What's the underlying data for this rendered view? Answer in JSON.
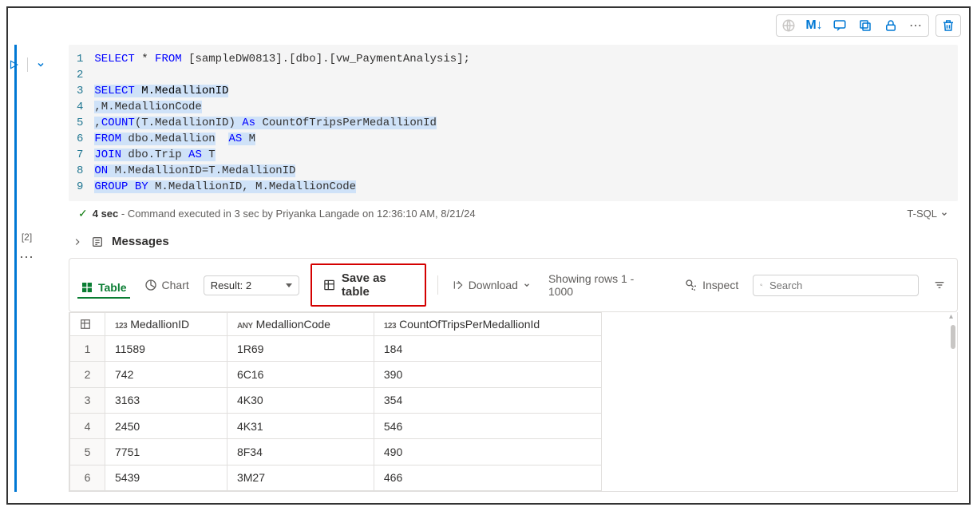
{
  "toolbar_top": {
    "md_label": "M↓"
  },
  "code": {
    "lines": [
      1,
      2,
      3,
      4,
      5,
      6,
      7,
      8,
      9
    ],
    "l1": {
      "a": "SELECT",
      "b": "*",
      "c": "FROM",
      "d": "[sampleDW0813].[dbo].[vw_PaymentAnalysis];"
    },
    "l3": {
      "a": "SELECT",
      "b": "M.MedallionID"
    },
    "l4": {
      "a": ",M.MedallionCode"
    },
    "l5": {
      "a": ",",
      "b": "COUNT",
      "c": "(T.MedallionID)",
      "d": "As",
      "e": "CountOfTripsPerMedallionId"
    },
    "l6": {
      "a": "FROM",
      "b": "dbo.Medallion",
      "c": "AS",
      "d": "M"
    },
    "l7": {
      "a": "JOIN",
      "b": "dbo.Trip",
      "c": "AS",
      "d": "T"
    },
    "l8": {
      "a": "ON",
      "b": "M.MedallionID=T.MedallionID"
    },
    "l9": {
      "a": "GROUP BY",
      "b": "M.MedallionID, M.MedallionCode"
    }
  },
  "cell_index": "[2]",
  "status": {
    "time": "4 sec",
    "msg": " - Command executed in 3 sec by Priyanka Langade on 12:36:10 AM, 8/21/24",
    "lang": "T-SQL"
  },
  "messages_title": "Messages",
  "results_bar": {
    "table": "Table",
    "chart": "Chart",
    "result_dd": "Result: 2",
    "save": "Save as table",
    "download": "Download",
    "showing": "Showing rows 1 - 1000",
    "inspect": "Inspect",
    "search_ph": "Search"
  },
  "table": {
    "cols": [
      {
        "type": "123",
        "name": "MedallionID"
      },
      {
        "type": "ANY",
        "name": "MedallionCode"
      },
      {
        "type": "123",
        "name": "CountOfTripsPerMedallionId"
      }
    ],
    "rows": [
      {
        "n": 1,
        "c": [
          "11589",
          "1R69",
          "184"
        ]
      },
      {
        "n": 2,
        "c": [
          "742",
          "6C16",
          "390"
        ]
      },
      {
        "n": 3,
        "c": [
          "3163",
          "4K30",
          "354"
        ]
      },
      {
        "n": 4,
        "c": [
          "2450",
          "4K31",
          "546"
        ]
      },
      {
        "n": 5,
        "c": [
          "7751",
          "8F34",
          "490"
        ]
      },
      {
        "n": 6,
        "c": [
          "5439",
          "3M27",
          "466"
        ]
      }
    ]
  }
}
